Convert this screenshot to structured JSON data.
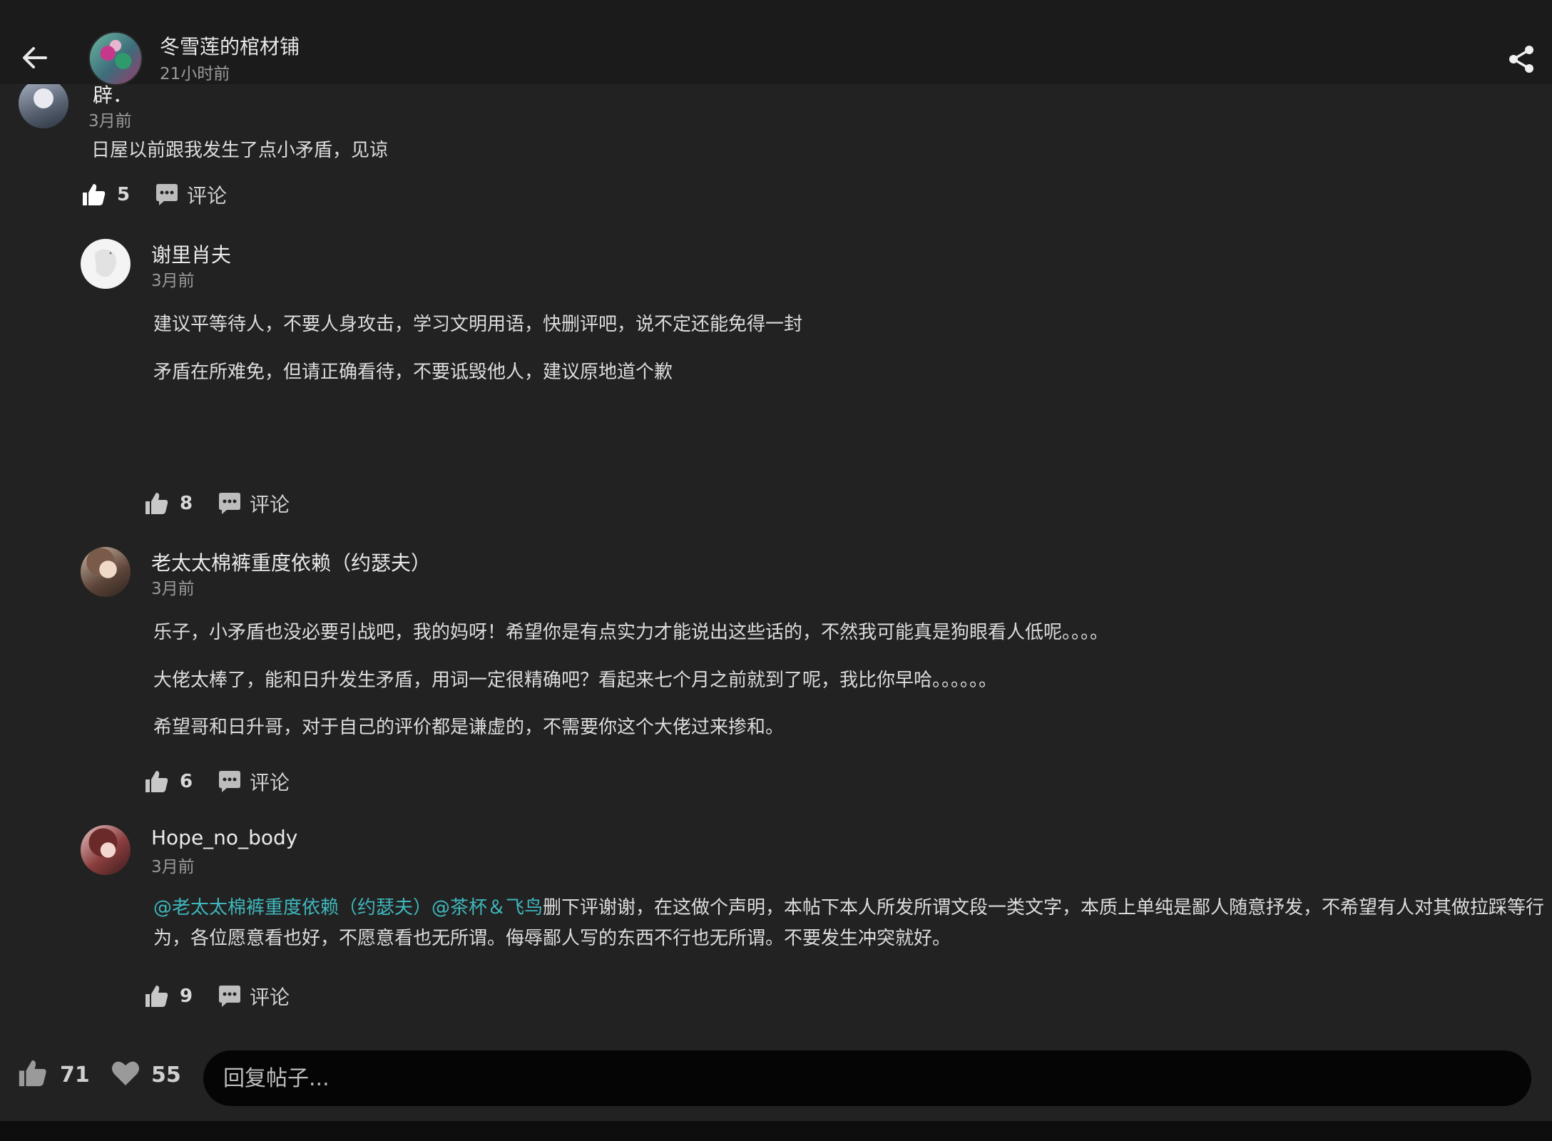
{
  "header": {
    "title": "冬雪莲的棺材铺",
    "subtitle": "21小时前",
    "back_icon": "arrow-left-icon",
    "share_icon": "share-icon"
  },
  "comments": [
    {
      "author": "辟．",
      "time": "3月前",
      "paragraphs": [
        "日屋以前跟我发生了点小矛盾，见谅"
      ],
      "likes": "5",
      "comment_label": "评论"
    },
    {
      "author": "谢里肖夫",
      "time": "3月前",
      "paragraphs": [
        "建议平等待人，不要人身攻击，学习文明用语，快删评吧，说不定还能免得一封",
        "矛盾在所难免，但请正确看待，不要诋毁他人，建议原地道个歉"
      ],
      "likes": "8",
      "comment_label": "评论"
    },
    {
      "author": "老太太棉裤重度依赖（约瑟夫）",
      "time": "3月前",
      "paragraphs": [
        "乐子，小矛盾也没必要引战吧，我的妈呀！希望你是有点实力才能说出这些话的，不然我可能真是狗眼看人低呢。。。。",
        "大佬太棒了，能和日升发生矛盾，用词一定很精确吧？看起来七个月之前就到了呢，我比你早哈。。。。。。",
        "希望哥和日升哥，对于自己的评价都是谦虚的，不需要你这个大佬过来掺和。"
      ],
      "likes": "6",
      "comment_label": "评论"
    },
    {
      "author": "Hope_no_body",
      "time": "3月前",
      "mention1": "@老太太棉裤重度依赖（约瑟夫）",
      "mention2": "@茶杯＆飞鸟",
      "body": "删下评谢谢，在这做个声明，本帖下本人所发所谓文段一类文字，本质上单纯是鄙人随意抒发，不希望有人对其做拉踩等行为，各位愿意看也好，不愿意看也无所谓。侮辱鄙人写的东西不行也无所谓。不要发生冲突就好。",
      "likes": "9",
      "comment_label": "评论"
    }
  ],
  "footer": {
    "likes": "71",
    "favorites": "55",
    "reply_placeholder": "回复帖子..."
  },
  "colors": {
    "background": "#222222",
    "topbar": "#1b1b1b",
    "mention": "#3fb7bd",
    "input": "#050505"
  }
}
